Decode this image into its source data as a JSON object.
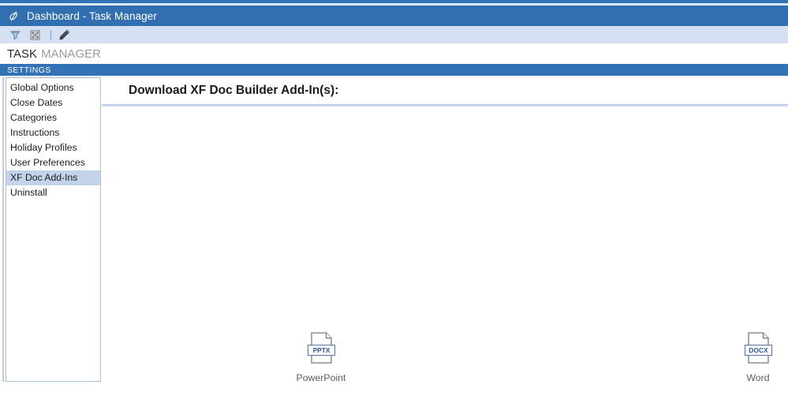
{
  "window": {
    "title": "Dashboard - Task Manager",
    "icon": "app-logo-icon"
  },
  "toolbar": {
    "items": [
      {
        "name": "filter-icon",
        "label": "Filter"
      },
      {
        "name": "grid-settings-icon",
        "label": "Grid Settings"
      },
      {
        "name": "edit-pencil-icon",
        "label": "Edit"
      }
    ]
  },
  "product": {
    "name_strong": "TASK",
    "name_light": "MANAGER"
  },
  "settings_bar": {
    "label": "SETTINGS"
  },
  "sidebar": {
    "items": [
      {
        "label": "Global Options",
        "selected": false
      },
      {
        "label": "Close Dates",
        "selected": false
      },
      {
        "label": "Categories",
        "selected": false
      },
      {
        "label": "Instructions",
        "selected": false
      },
      {
        "label": "Holiday Profiles",
        "selected": false
      },
      {
        "label": "User Preferences",
        "selected": false
      },
      {
        "label": "XF Doc Add-Ins",
        "selected": true
      },
      {
        "label": "Uninstall",
        "selected": false
      }
    ]
  },
  "content": {
    "heading": "Download XF Doc Builder Add-In(s):",
    "tiles": [
      {
        "label": "PowerPoint",
        "badge": "PPTX",
        "icon": "pptx-file-icon"
      },
      {
        "label": "Word",
        "badge": "DOCX",
        "icon": "docx-file-icon"
      }
    ]
  },
  "colors": {
    "title_bar": "#326fb1",
    "accent": "#3372b5",
    "toolbar_bg": "#d6e0f3",
    "selection": "#c3d3e9",
    "badge_text": "#2f5496"
  }
}
